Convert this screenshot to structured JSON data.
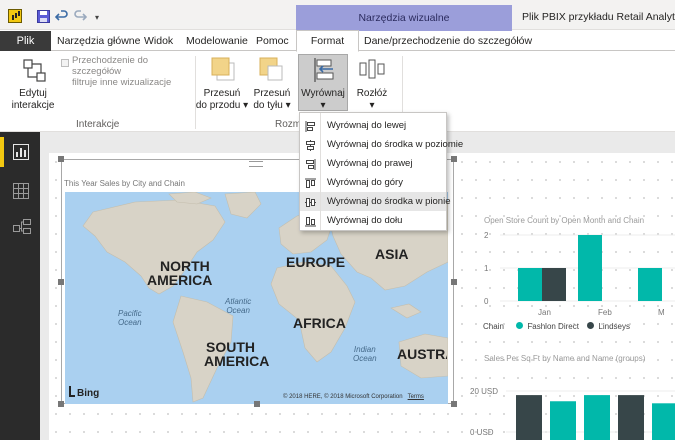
{
  "titlebar": {
    "tools_band": "Narzędzia wizualne",
    "file_title": "Plik PBIX przykładu Retail Analyt"
  },
  "tabs": {
    "file": "Plik",
    "home": "Narzędzia główne",
    "view": "Widok",
    "modeling": "Modelowanie",
    "help": "Pomoc",
    "format": "Format",
    "data_drill": "Dane/przechodzenie do szczegółów"
  },
  "ribbon": {
    "edit_interactions": [
      "Edytuj",
      "interakcje"
    ],
    "drill_filter_checkbox": [
      "Przechodzenie do szczegółów",
      "filtruje inne wizualizacje"
    ],
    "group_interactions": "Interakcje",
    "bring_forward": [
      "Przesuń",
      "do przodu"
    ],
    "send_backward": [
      "Przesuń",
      "do tyłu"
    ],
    "align": "Wyrównaj",
    "distribute": "Rozłóż",
    "group_arrange": "Rozm"
  },
  "align_menu": [
    {
      "label": "Wyrównaj do lewej",
      "icon": "align-left-icon"
    },
    {
      "label": "Wyrównaj do środka w poziomie",
      "icon": "align-center-horizontal-icon"
    },
    {
      "label": "Wyrównaj do prawej",
      "icon": "align-right-icon"
    },
    {
      "label": "Wyrównaj do góry",
      "icon": "align-top-icon"
    },
    {
      "label": "Wyrównaj do środka w pionie",
      "icon": "align-middle-vertical-icon"
    },
    {
      "label": "Wyrównaj do dołu",
      "icon": "align-bottom-icon"
    }
  ],
  "sidebar": [
    {
      "name": "report-view-icon",
      "active": true
    },
    {
      "name": "data-view-icon",
      "active": false
    },
    {
      "name": "model-view-icon",
      "active": false
    }
  ],
  "map_visual": {
    "title": "This Year Sales by City and Chain",
    "continents": [
      "NORTH",
      "AMERICA",
      "EUROPE",
      "ASIA",
      "AFRICA",
      "SOUTH",
      "AMERICA",
      "AUSTRA"
    ],
    "oceans": {
      "pacific": [
        "Pacific",
        "Ocean"
      ],
      "atlantic": [
        "Atlantic",
        "Ocean"
      ],
      "indian": [
        "Indian",
        "Ocean"
      ]
    },
    "provider": "Bing",
    "copyright": "© 2018 HERE, © 2018 Microsoft Corporation",
    "terms": "Terms"
  },
  "chart_data": [
    {
      "type": "bar",
      "title": "Open Store Count by Open Month and Chain",
      "categories": [
        "Jan",
        "Feb",
        "M"
      ],
      "series": [
        {
          "name": "Fashion Direct",
          "values": [
            1,
            2,
            1
          ]
        },
        {
          "name": "Lindseys",
          "values": [
            1,
            null,
            null
          ]
        }
      ],
      "ylim": [
        0,
        2
      ],
      "yticks": [
        "2",
        "1",
        "0"
      ],
      "legend_title": "Chain",
      "legend_position": "bottom",
      "colors": {
        "Fashion Direct": "#01b8aa",
        "Lindseys": "#374649"
      }
    },
    {
      "type": "bar",
      "title": "Sales Per Sq Ft by Name and Name (groups)",
      "yticks": [
        "20 USD",
        "0 USD"
      ],
      "values_partial": [
        18,
        15,
        18,
        18,
        14
      ],
      "colors": [
        "#374649",
        "#01b8aa",
        "#01b8aa",
        "#374649",
        "#01b8aa"
      ]
    }
  ]
}
